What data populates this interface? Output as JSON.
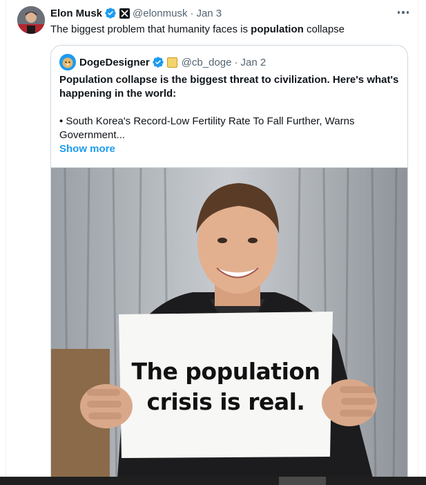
{
  "tweet": {
    "author_name": "Elon Musk",
    "handle": "@elonmusk",
    "separator": "·",
    "date": "Jan 3",
    "text_before": "The biggest problem that humanity faces is ",
    "text_bold": "population",
    "text_after": " collapse"
  },
  "quote": {
    "author_name": "DogeDesigner",
    "handle": "@cb_doge",
    "separator": "·",
    "date": "Jan 2",
    "headline": "Population collapse is the biggest threat to civilization. Here's what's happening in the world:",
    "bullet": "• South Korea's Record-Low Fertility Rate To Fall Further, Warns Government...",
    "show_more": "Show more",
    "image_sign_line1": "The population",
    "image_sign_line2": "crisis is real."
  },
  "colors": {
    "accent": "#1d9bf0",
    "secondary_text": "#536471",
    "border": "#cfd9de"
  },
  "icons": {
    "verified": "verified-badge-icon",
    "affiliation": "x-logo-icon",
    "more": "more-options-icon"
  }
}
